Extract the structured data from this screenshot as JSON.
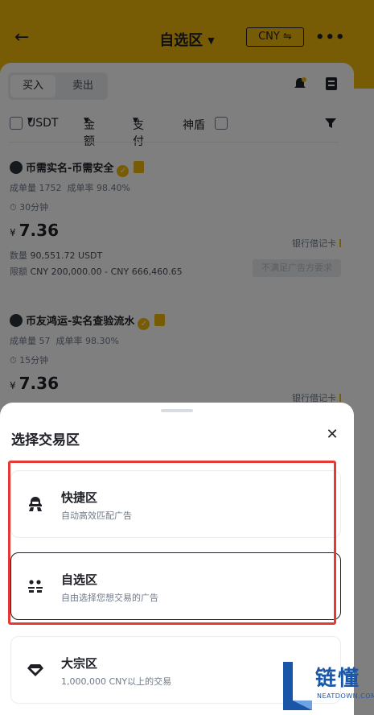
{
  "header": {
    "back_icon": "arrow-left-icon",
    "title": "自选区",
    "currency_button": "CNY ⇋",
    "more_icon": "more-horizontal-icon",
    "background_color": "#f0b90b"
  },
  "trade_toggle": {
    "buy": "买入",
    "sell": "卖出"
  },
  "filters": {
    "asset": "USDT",
    "amount": "金额",
    "payment": "支付",
    "shield": "神盾"
  },
  "ads": [
    {
      "merchant": "币需实名-币需安全",
      "orders_label": "成单量",
      "orders": "1752",
      "rate_label": "成单率",
      "rate": "98.40%",
      "time": "30分钟",
      "currency_symbol": "¥",
      "price": "7.36",
      "qty_label": "数量",
      "qty": "90,551.72 USDT",
      "limit_label": "限额",
      "limit": "CNY 200,000.00 - CNY 666,460.65",
      "payment": "银行借记卡",
      "status_button": "不满足广告方要求"
    },
    {
      "merchant": "币友鸿运-实名查验流水",
      "orders_label": "成单量",
      "orders": "57",
      "rate_label": "成单率",
      "rate": "98.30%",
      "time": "15分钟",
      "currency_symbol": "¥",
      "price": "7.36",
      "payment": "银行借记卡"
    }
  ],
  "sheet": {
    "title": "选择交易区",
    "close_icon": "close-icon",
    "options": [
      {
        "icon": "express-agent-icon",
        "name": "快捷区",
        "desc": "自动高效匹配广告"
      },
      {
        "icon": "users-icon",
        "name": "自选区",
        "desc": "自由选择您想交易的广告",
        "selected": true
      },
      {
        "icon": "diamond-icon",
        "name": "大宗区",
        "desc": "1,000,000 CNY以上的交易"
      }
    ]
  },
  "watermark": {
    "text": "链懂",
    "sub": "NEATDOWN.COM"
  },
  "colors": {
    "accent": "#f0b90b",
    "highlight_border": "#e53935",
    "watermark": "#1a56a8"
  }
}
